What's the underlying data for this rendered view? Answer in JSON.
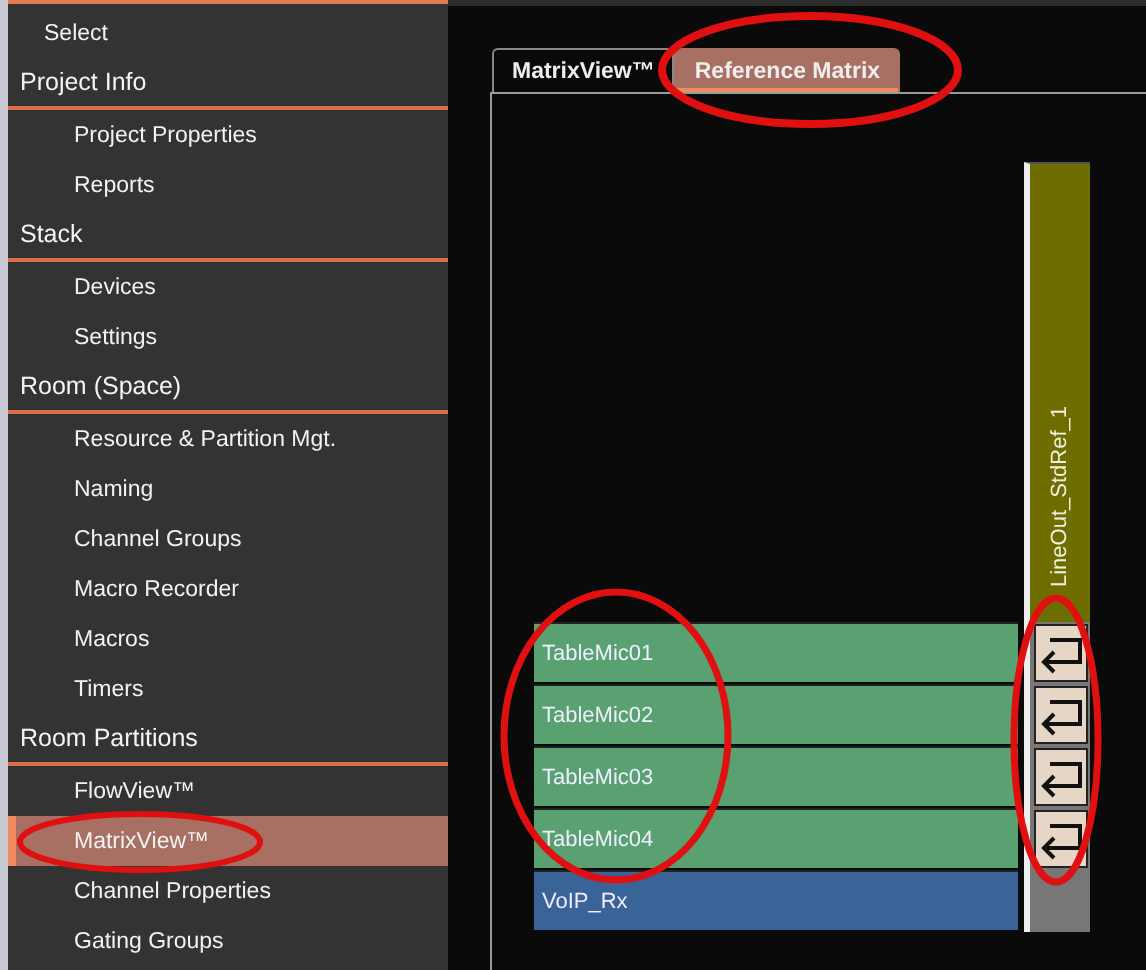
{
  "sidebar": {
    "top_item": {
      "label": "Select",
      "selected": false
    },
    "sections": [
      {
        "title": "Project Info",
        "items": [
          {
            "label": "Project Properties",
            "selected": false
          },
          {
            "label": "Reports",
            "selected": false
          }
        ]
      },
      {
        "title": "Stack",
        "items": [
          {
            "label": "Devices",
            "selected": false
          },
          {
            "label": "Settings",
            "selected": false
          }
        ]
      },
      {
        "title": "Room (Space)",
        "items": [
          {
            "label": "Resource & Partition Mgt.",
            "selected": false
          },
          {
            "label": "Naming",
            "selected": false
          },
          {
            "label": "Channel Groups",
            "selected": false
          },
          {
            "label": "Macro Recorder",
            "selected": false
          },
          {
            "label": "Macros",
            "selected": false
          },
          {
            "label": "Timers",
            "selected": false
          }
        ]
      },
      {
        "title": "Room Partitions",
        "items": [
          {
            "label": "FlowView™",
            "selected": false
          },
          {
            "label": "MatrixView™",
            "selected": true
          },
          {
            "label": "Channel Properties",
            "selected": false
          },
          {
            "label": "Gating Groups",
            "selected": false
          }
        ]
      }
    ]
  },
  "tabs": [
    {
      "label": "MatrixView™",
      "selected": false
    },
    {
      "label": "Reference Matrix",
      "selected": true
    }
  ],
  "matrix": {
    "columns": [
      {
        "label": "LineOut_StdRef_1",
        "color": "#6e6e00"
      }
    ],
    "rows": [
      {
        "label": "TableMic01",
        "color": "#5aa172",
        "routed": true
      },
      {
        "label": "TableMic02",
        "color": "#5aa172",
        "routed": true
      },
      {
        "label": "TableMic03",
        "color": "#5aa172",
        "routed": true
      },
      {
        "label": "TableMic04",
        "color": "#5aa172",
        "routed": true
      },
      {
        "label": "VoIP_Rx",
        "color": "#3a6497",
        "routed": false
      }
    ]
  }
}
